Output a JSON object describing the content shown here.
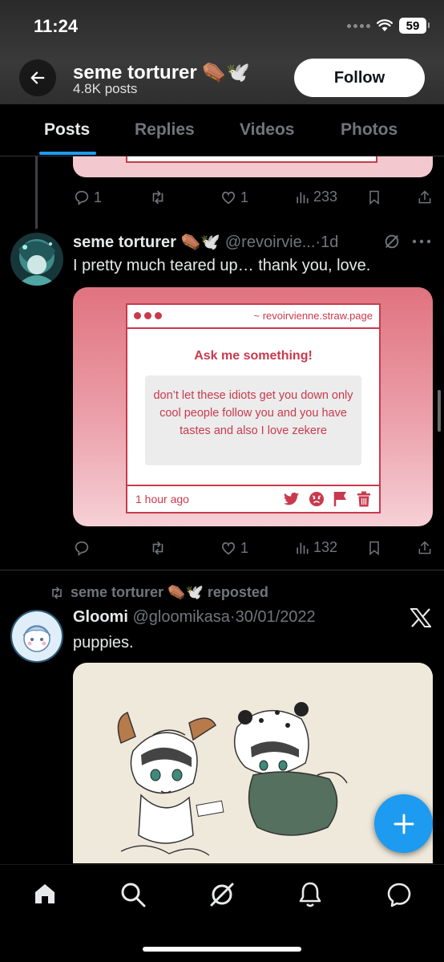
{
  "status": {
    "time": "11:24",
    "battery": "59"
  },
  "profile": {
    "name": "seme torturer ⚰️🕊️",
    "posts_count": "4.8K posts",
    "follow_label": "Follow"
  },
  "tabs": [
    "Posts",
    "Replies",
    "Videos",
    "Photos"
  ],
  "prev_post_actions": {
    "replies": "1",
    "likes": "1",
    "views": "233"
  },
  "post1": {
    "name": "seme torturer ⚰️🕊️",
    "handle": "@revoirvie...",
    "time": "·1d",
    "text": "I pretty much teared up… thank you, love.",
    "card": {
      "url": "~ revoirvienne.straw.page",
      "title": "Ask me something!",
      "message": "don’t let these idiots get you down only cool people follow you and you have tastes and also I love zekere",
      "time": "1 hour ago"
    },
    "actions": {
      "likes": "1",
      "views": "132"
    }
  },
  "repost": {
    "label": "seme torturer ⚰️🕊️ reposted"
  },
  "post2": {
    "name": "Gloomi",
    "handle": "@gloomikasa",
    "time": "·30/01/2022",
    "text": "puppies."
  },
  "colors": {
    "accent": "#1d9bf0",
    "card_red": "#c83a4d",
    "muted": "#71767b"
  }
}
